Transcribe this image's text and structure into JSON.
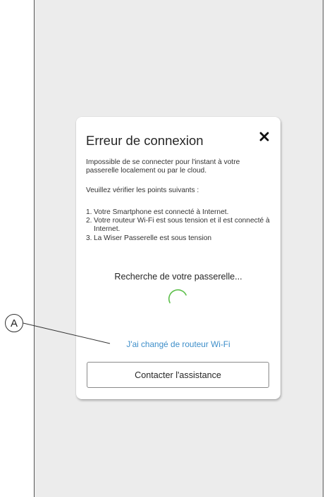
{
  "dialog": {
    "title": "Erreur de connexion",
    "message": "Impossible de se connecter pour l'instant à votre passerelle localement ou par le cloud.",
    "instruction": "Veuillez vérifier les points suivants :",
    "checks": [
      {
        "num": "1.",
        "text": "Votre Smartphone est connecté à Internet."
      },
      {
        "num": "2.",
        "text": "Votre routeur Wi-Fi est sous tension et il est connecté à Internet."
      },
      {
        "num": "3.",
        "text": "La Wiser Passerelle est sous tension"
      }
    ],
    "status": "Recherche de votre passerelle...",
    "router_link": "J'ai changé de routeur Wi-Fi",
    "support_button": "Contacter l'assistance"
  },
  "annotation": {
    "callout_label": "A"
  },
  "icons": {
    "close": "close-icon",
    "spinner": "loading-spinner-icon"
  },
  "colors": {
    "link": "#3d8ec9",
    "spinner": "#5cbf4a",
    "screen_background": "#ececec"
  }
}
